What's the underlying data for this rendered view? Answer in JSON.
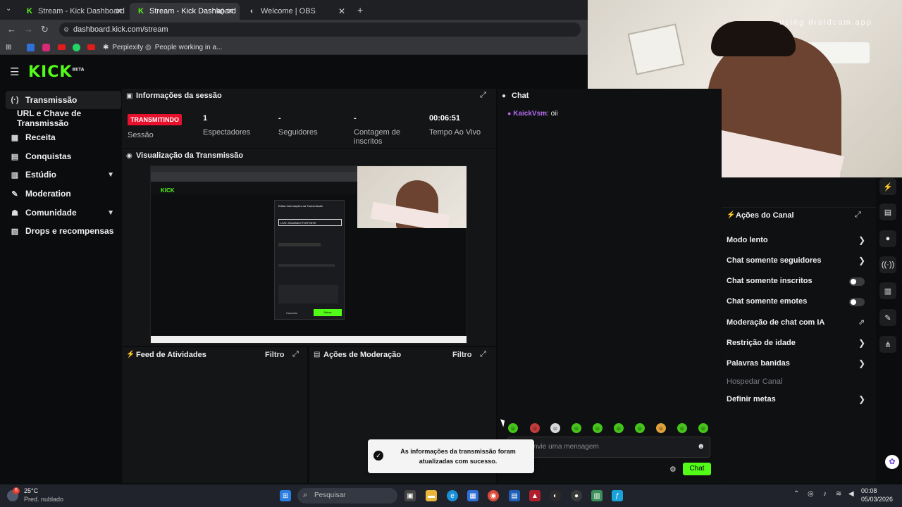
{
  "browser": {
    "tabs": [
      {
        "label": "Stream - Kick Dashboard",
        "fav": "K",
        "fav_color": "#53fc18"
      },
      {
        "label": "Stream - Kick Dashboard",
        "fav": "K",
        "fav_color": "#53fc18"
      },
      {
        "label": "Welcome | OBS",
        "fav": "◐",
        "fav_color": "#bbbbbb"
      }
    ],
    "url": "dashboard.kick.com/stream",
    "bookmarks": [
      {
        "label": "Perplexity"
      },
      {
        "label": "People working in a..."
      }
    ]
  },
  "kick": {
    "logo": "KICK",
    "logo_tag": "BETA"
  },
  "nav": [
    {
      "label": "Transmissão",
      "icon": "(·)"
    },
    {
      "label": "URL e Chave de Transmissão",
      "icon": ""
    },
    {
      "label": "Receita",
      "icon": "▦"
    },
    {
      "label": "Conquistas",
      "icon": "▤"
    },
    {
      "label": "Estúdio",
      "icon": "▥"
    },
    {
      "label": "Moderation",
      "icon": "✎"
    },
    {
      "label": "Comunidade",
      "icon": "☗"
    },
    {
      "label": "Drops e recompensas",
      "icon": "▨"
    }
  ],
  "session": {
    "title": "Informações da sessão",
    "live_badge": "TRANSMITINDO",
    "session_label": "Sessão",
    "stats": [
      {
        "value": "1",
        "label": "Espectadores"
      },
      {
        "value": "-",
        "label": "Seguidores"
      },
      {
        "value": "-",
        "label": "Contagem de inscritos"
      },
      {
        "value": "00:06:51",
        "label": "Tempo Ao Vivo"
      }
    ]
  },
  "preview": {
    "title": "Visualização da Transmissão",
    "mini_logo": "KICK",
    "mini_dialog_title": "Editar Informações da Transmissão",
    "mini_input": "LIVE JOGANDO FORTNITE",
    "mini_cancel": "Cancelar",
    "mini_save": "Salvar"
  },
  "feed": {
    "title": "Feed de Atividades",
    "filter": "Filtro"
  },
  "modactions": {
    "title": "Ações de Moderação",
    "filter": "Filtro"
  },
  "chat": {
    "title": "Chat",
    "messages": [
      {
        "user": "KaickVsm",
        "text": "oii"
      }
    ],
    "placeholder": "nvie uma mensagem",
    "send_label": "Chat"
  },
  "toast": {
    "text": "As informações da transmissão foram atualizadas com sucesso."
  },
  "webcam": {
    "watermark": "using droidcam.app"
  },
  "channel_actions": {
    "title": "Ações do Canal",
    "items": [
      {
        "label": "Modo lento",
        "control": "chevron"
      },
      {
        "label": "Chat somente seguidores",
        "control": "chevron"
      },
      {
        "label": "Chat somente inscritos",
        "control": "toggle",
        "state": false
      },
      {
        "label": "Chat somente emotes",
        "control": "toggle",
        "state": false
      },
      {
        "label": "Moderação de chat com IA",
        "control": "external"
      },
      {
        "label": "Restrição de idade",
        "control": "chevron"
      },
      {
        "label": "Palavras banidas",
        "control": "chevron"
      },
      {
        "label": "Hospedar Canal",
        "control": "none",
        "disabled": true
      },
      {
        "label": "Definir metas",
        "control": "chevron"
      }
    ]
  },
  "taskbar": {
    "weather_temp": "25°C",
    "weather_desc": "Pred. nublado",
    "weather_badge": "6",
    "search": "Pesquisar",
    "time": "00:08",
    "date": "05/03/2026"
  },
  "colors": {
    "accent": "#53fc18",
    "live_red": "#e8112d"
  }
}
